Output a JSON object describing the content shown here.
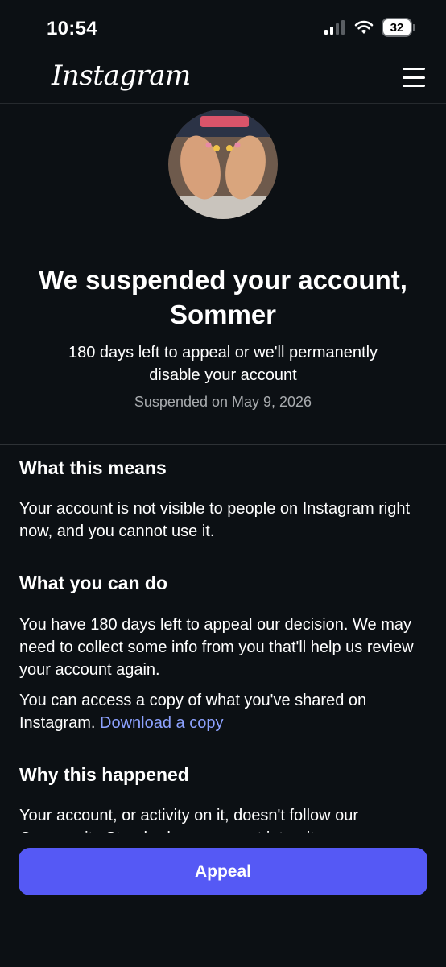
{
  "status_bar": {
    "time": "10:54",
    "battery": "32",
    "icons": [
      "cellular-signal-icon",
      "wifi-icon",
      "battery-icon"
    ]
  },
  "header": {
    "logo_text": "Instagram",
    "menu_icon": "hamburger-menu-icon"
  },
  "hero": {
    "title": "We suspended your account, Sommer",
    "subtitle": "180 days left to appeal or we'll permanently disable your account",
    "suspended_date": "Suspended on May 9, 2026"
  },
  "sections": {
    "means": {
      "heading": "What this means",
      "body": "Your account is not visible to people on Instagram right now, and you cannot use it."
    },
    "can_do": {
      "heading": "What you can do",
      "body": "You have 180 days left to appeal our decision. We may need to collect some info from you that'll help us review your account again.",
      "access_text": "You can access a copy of what you've shared on Instagram. ",
      "download_link": "Download a copy"
    },
    "why": {
      "heading": "Why this happened",
      "body": "Your account, or activity on it, doesn't follow our Community Standards on account integrity."
    }
  },
  "footer": {
    "appeal_label": "Appeal"
  },
  "colors": {
    "background": "#0c1014",
    "accent_button": "#5559f5",
    "link": "#8da2ff",
    "muted_text": "#a8abae"
  }
}
